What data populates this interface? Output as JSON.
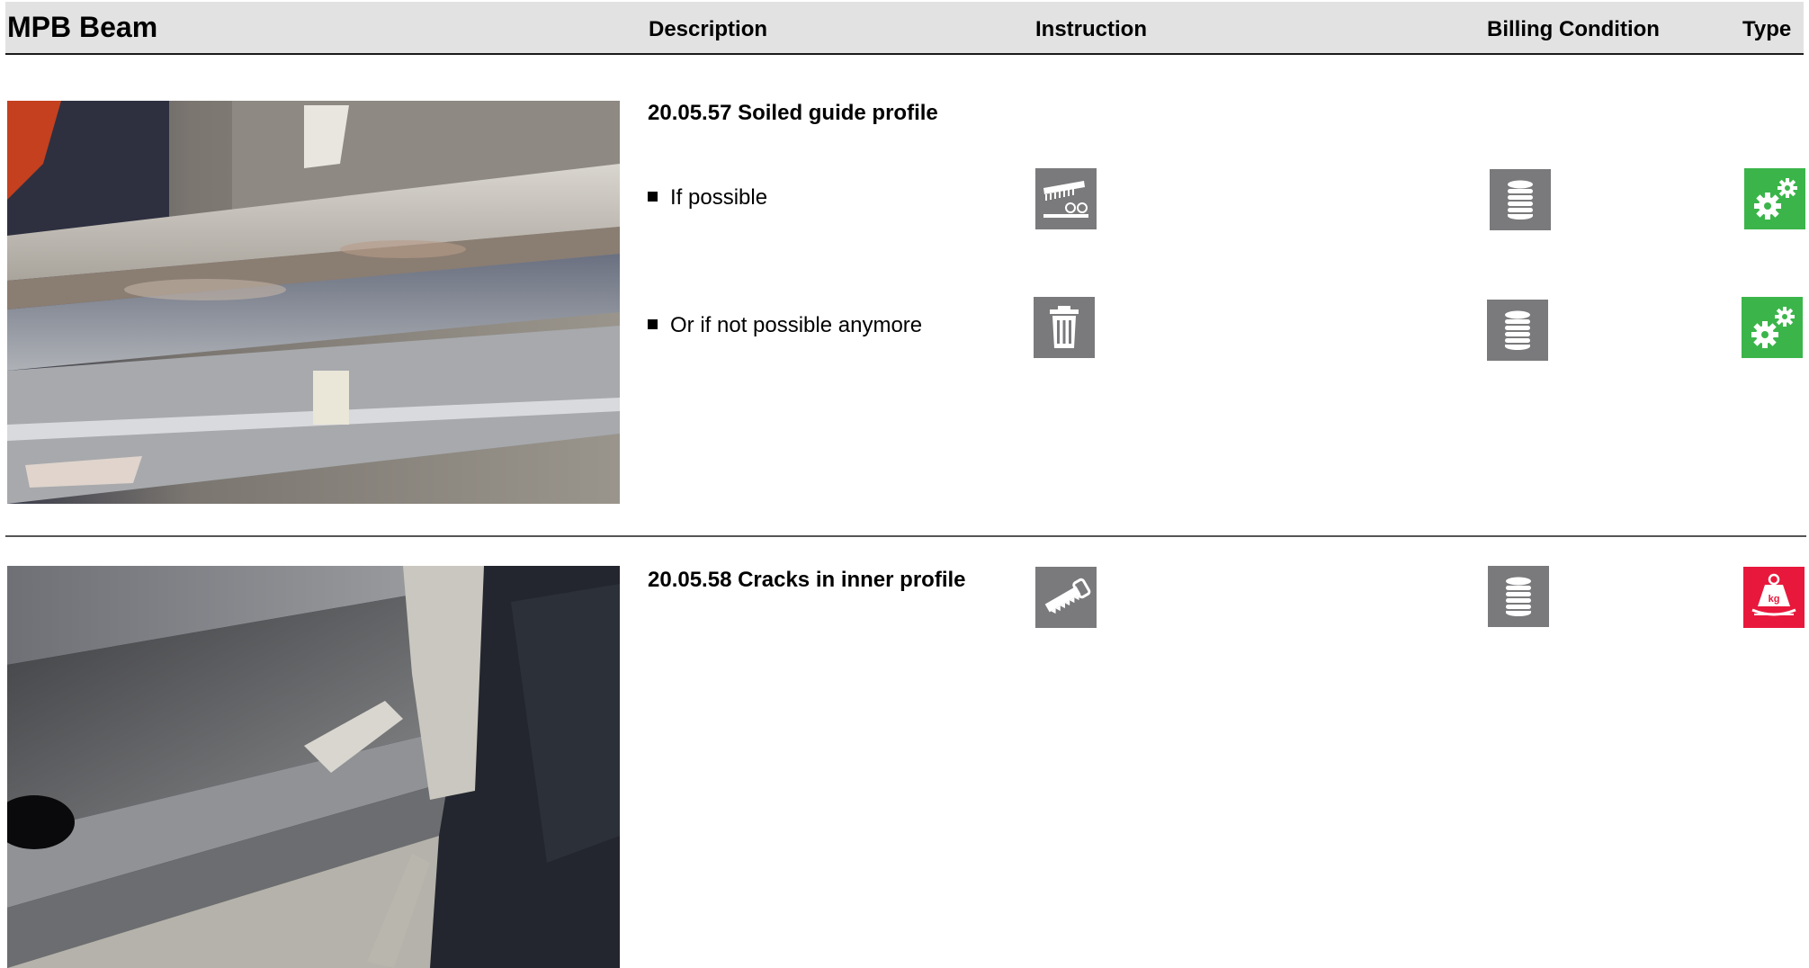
{
  "header": {
    "title": "MPB Beam",
    "col_description": "Description",
    "col_instruction": "Instruction",
    "col_billing": "Billing Condition",
    "col_type": "Type"
  },
  "items": [
    {
      "title": "20.05.57 Soiled guide profile",
      "rows": [
        {
          "text": "If possible",
          "instruction_icon": "cleaning-machine-icon",
          "billing_icon": "coin-stack-icon",
          "type_icon": "gears-icon"
        },
        {
          "text": "Or if not possible anymore",
          "instruction_icon": "trash-bin-icon",
          "billing_icon": "coin-stack-icon",
          "type_icon": "gears-icon"
        }
      ]
    },
    {
      "title": "20.05.58 Cracks in inner profile",
      "rows": [
        {
          "text": "",
          "instruction_icon": "saw-icon",
          "billing_icon": "coin-stack-icon",
          "type_icon": "weight-kg-icon"
        }
      ]
    }
  ],
  "colors": {
    "header_bg": "#e2e2e2",
    "icon_gray": "#7a7a7c",
    "type_green": "#3bb54a",
    "type_red": "#e8183c"
  }
}
